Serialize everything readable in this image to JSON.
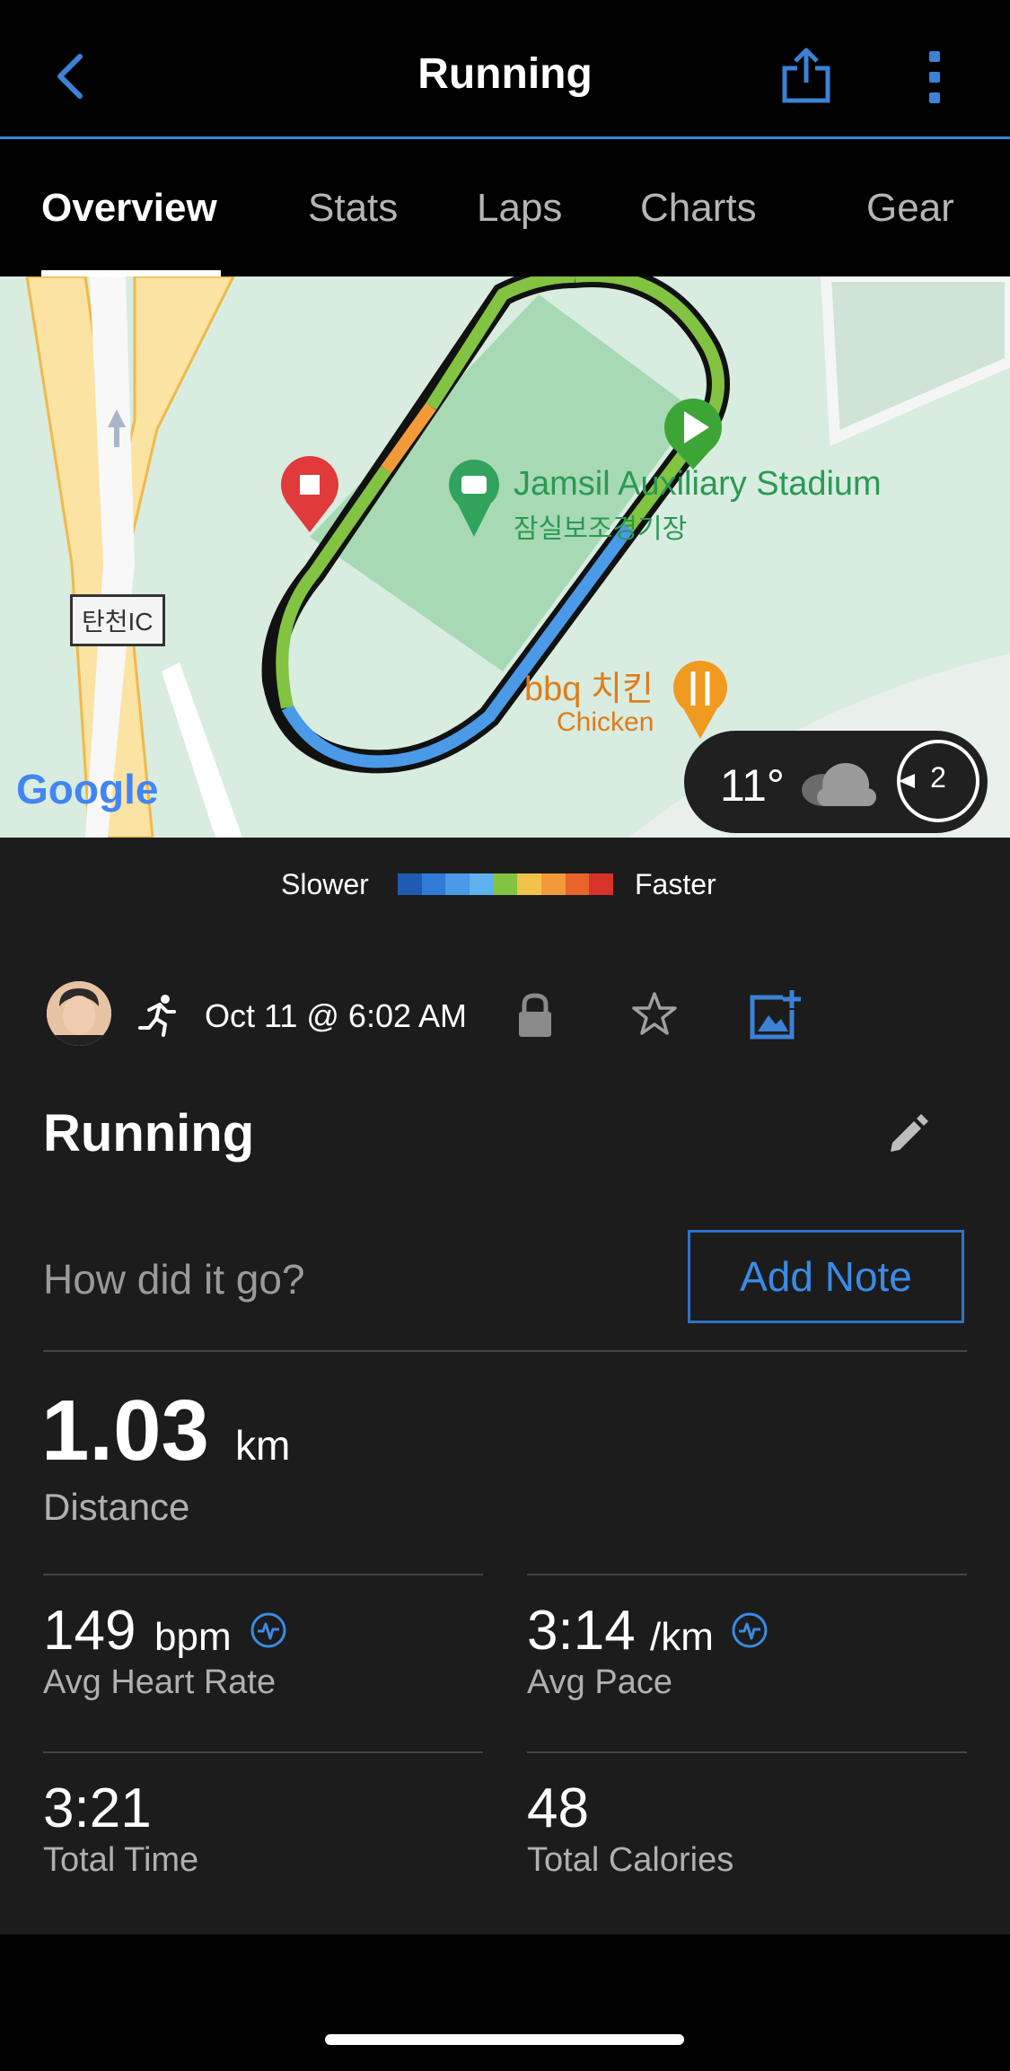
{
  "header": {
    "title": "Running"
  },
  "tabs": [
    {
      "label": "Overview",
      "active": true
    },
    {
      "label": "Stats"
    },
    {
      "label": "Laps"
    },
    {
      "label": "Charts"
    },
    {
      "label": "Gear"
    }
  ],
  "map": {
    "stadium_name": "Jamsil Auxiliary Stadium",
    "stadium_name_ko": "잠실보조경기장",
    "ic_label": "탄천IC",
    "restaurant_name": "bbq 치킨",
    "restaurant_sub": "Chicken",
    "attribution": "Google",
    "weather": {
      "temp": "11°",
      "icon": "cloud-icon",
      "laps": "2"
    }
  },
  "legend": {
    "slower": "Slower",
    "faster": "Faster",
    "colors": [
      "#1f5bb0",
      "#2f7bd6",
      "#4a9ae8",
      "#5fb0ef",
      "#82c341",
      "#f2c24b",
      "#f29a3a",
      "#e8642a",
      "#d7322b"
    ]
  },
  "activity": {
    "date": "Oct 11 @ 6:02 AM",
    "title": "Running",
    "note_placeholder": "How did it go?",
    "add_note_label": "Add Note"
  },
  "stats": {
    "distance": {
      "value": "1.03",
      "unit": "km",
      "label": "Distance"
    },
    "heart_rate": {
      "value": "149",
      "unit": "bpm",
      "label": "Avg Heart Rate"
    },
    "pace": {
      "value": "3:14",
      "unit": "/km",
      "label": "Avg Pace"
    },
    "time": {
      "value": "3:21",
      "label": "Total Time"
    },
    "calories": {
      "value": "48",
      "label": "Total Calories"
    }
  },
  "colors": {
    "accent": "#3b82d6",
    "background": "#1c1c1c"
  }
}
